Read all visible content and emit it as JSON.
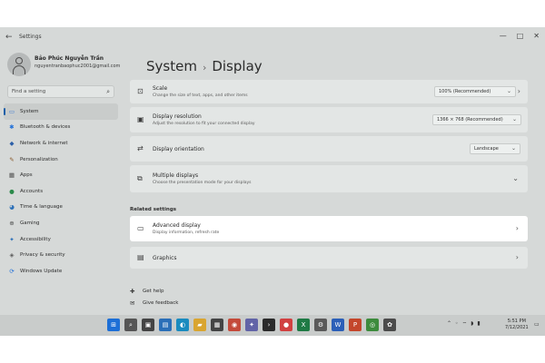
{
  "window": {
    "back": "←",
    "title": "Settings",
    "controls": [
      "—",
      "□",
      "✕"
    ]
  },
  "user": {
    "name": "Bảo Phúc Nguyễn Trần",
    "email": "nguyentranbaophuc2001@gmail.com"
  },
  "search": {
    "placeholder": "Find a setting",
    "icon": "search-icon"
  },
  "sidebar": {
    "items": [
      {
        "label": "System",
        "icon": "monitor-icon",
        "glyph": "▭",
        "color": "#3a7bd5",
        "active": true
      },
      {
        "label": "Bluetooth & devices",
        "icon": "bluetooth-icon",
        "glyph": "✱",
        "color": "#1e6fd9"
      },
      {
        "label": "Network & internet",
        "icon": "wifi-icon",
        "glyph": "◆",
        "color": "#2b5fa8"
      },
      {
        "label": "Personalization",
        "icon": "pen-icon",
        "glyph": "✎",
        "color": "#8a5a2b"
      },
      {
        "label": "Apps",
        "icon": "apps-icon",
        "glyph": "▦",
        "color": "#4b4b4b"
      },
      {
        "label": "Accounts",
        "icon": "person-icon",
        "glyph": "●",
        "color": "#2a8a4a"
      },
      {
        "label": "Time & language",
        "icon": "globe-clock-icon",
        "glyph": "◕",
        "color": "#2a6fb8"
      },
      {
        "label": "Gaming",
        "icon": "controller-icon",
        "glyph": "⊕",
        "color": "#4b4b4b"
      },
      {
        "label": "Accessibility",
        "icon": "accessibility-icon",
        "glyph": "✦",
        "color": "#2a6fb8"
      },
      {
        "label": "Privacy & security",
        "icon": "shield-icon",
        "glyph": "◈",
        "color": "#5a5a5a"
      },
      {
        "label": "Windows Update",
        "icon": "update-icon",
        "glyph": "⟳",
        "color": "#1e6fd9"
      }
    ]
  },
  "header": {
    "parent": "System",
    "separator": "›",
    "current": "Display"
  },
  "cards": {
    "scale": {
      "title": "Scale",
      "desc": "Change the size of text, apps, and other items",
      "value": "100% (Recommended)",
      "icon": "scale-icon"
    },
    "resolution": {
      "title": "Display resolution",
      "desc": "Adjust the resolution to fit your connected display",
      "value": "1366 × 768 (Recommended)",
      "icon": "resolution-icon"
    },
    "orientation": {
      "title": "Display orientation",
      "value": "Landscape",
      "icon": "orientation-icon"
    },
    "multiple": {
      "title": "Multiple displays",
      "desc": "Choose the presentation mode for your displays",
      "icon": "multiple-displays-icon"
    }
  },
  "related": {
    "section_title": "Related settings",
    "advanced": {
      "title": "Advanced display",
      "desc": "Display information, refresh rate",
      "icon": "monitor-icon"
    },
    "graphics": {
      "title": "Graphics",
      "icon": "graphics-icon"
    }
  },
  "footer": {
    "help": "Get help",
    "feedback": "Give feedback"
  },
  "taskbar": {
    "apps": [
      {
        "name": "start-icon",
        "glyph": "⊞",
        "bg": "#1d6fd6"
      },
      {
        "name": "search-icon",
        "glyph": "⌕",
        "bg": "#555555"
      },
      {
        "name": "task-view-icon",
        "glyph": "▣",
        "bg": "#444444"
      },
      {
        "name": "widgets-icon",
        "glyph": "▤",
        "bg": "#2a6fb8"
      },
      {
        "name": "edge-icon",
        "glyph": "◐",
        "bg": "#1a8bbf"
      },
      {
        "name": "file-explorer-icon",
        "glyph": "▰",
        "bg": "#d9a531"
      },
      {
        "name": "store-icon",
        "glyph": "▦",
        "bg": "#444444"
      },
      {
        "name": "photos-icon",
        "glyph": "◉",
        "bg": "#c44a3a"
      },
      {
        "name": "teams-icon",
        "glyph": "✦",
        "bg": "#6264a7"
      },
      {
        "name": "terminal-icon",
        "glyph": "›",
        "bg": "#2b2b2b"
      },
      {
        "name": "app-badge-icon",
        "glyph": "●",
        "bg": "#d14040"
      },
      {
        "name": "excel-icon",
        "glyph": "X",
        "bg": "#1f7a45"
      },
      {
        "name": "settings-gear-icon",
        "glyph": "⚙",
        "bg": "#5a5a5a"
      },
      {
        "name": "word-icon",
        "glyph": "W",
        "bg": "#2b5fb8"
      },
      {
        "name": "powerpoint-icon",
        "glyph": "P",
        "bg": "#c4462b"
      },
      {
        "name": "chrome-icon",
        "glyph": "◎",
        "bg": "#3d8b3d"
      },
      {
        "name": "settings-icon",
        "glyph": "✿",
        "bg": "#4b4b4b"
      }
    ],
    "tray": [
      "⌃",
      "◦",
      "⌔",
      "◗",
      "▮"
    ],
    "time": "5:51 PM",
    "date": "7/12/2021",
    "notification": "▭"
  }
}
